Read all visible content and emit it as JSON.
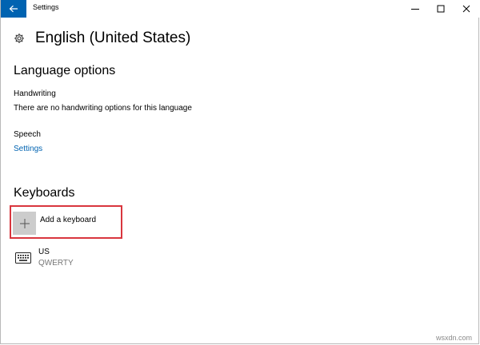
{
  "window": {
    "title": "Settings"
  },
  "page": {
    "title": "English (United States)"
  },
  "language_options": {
    "heading": "Language options",
    "handwriting_label": "Handwriting",
    "handwriting_desc": "There are no handwriting options for this language",
    "speech_label": "Speech",
    "speech_link": "Settings"
  },
  "keyboards": {
    "heading": "Keyboards",
    "add_label": "Add a keyboard",
    "items": [
      {
        "name": "US",
        "layout": "QWERTY"
      }
    ]
  },
  "watermark": "wsxdn.com",
  "colors": {
    "accent": "#0063b1",
    "highlight": "#d9363e",
    "tile": "#cccccc",
    "secondary_text": "#767676"
  },
  "icons": {
    "back": "back-arrow-icon",
    "minimize": "minimize-icon",
    "maximize": "maximize-icon",
    "close": "close-icon",
    "gear": "gear-icon",
    "add": "plus-icon",
    "keyboard": "keyboard-icon"
  }
}
